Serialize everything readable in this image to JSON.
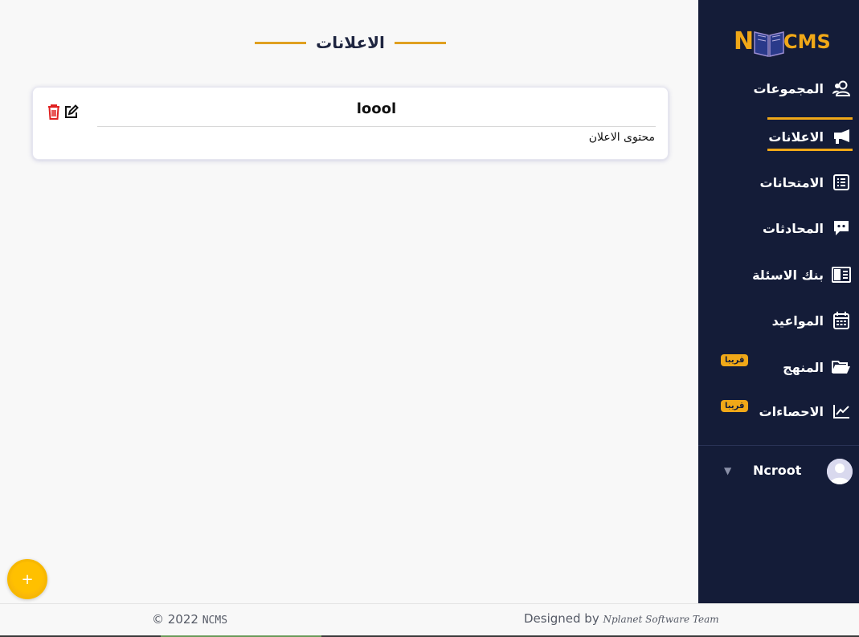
{
  "brand": {
    "logo_n": "N",
    "logo_cms": "CMS"
  },
  "sidebar": {
    "items": [
      {
        "label": "المجموعات",
        "icon": "users-icon"
      },
      {
        "label": "الاعلانات",
        "icon": "megaphone-icon"
      },
      {
        "label": "الامتحانات",
        "icon": "list-icon"
      },
      {
        "label": "المحادثات",
        "icon": "chat-icon"
      },
      {
        "label": "بنك الاسئلة",
        "icon": "book-icon"
      },
      {
        "label": "المواعيد",
        "icon": "calendar-icon"
      },
      {
        "label": "المنهج",
        "icon": "folder-open-icon",
        "badge": "قريبا"
      },
      {
        "label": "الاحصاءات",
        "icon": "chart-line-icon",
        "badge": "قريبا"
      }
    ],
    "active_index": 1,
    "user": {
      "name": "Ncroot"
    }
  },
  "main": {
    "title": "الاعلانات",
    "announcements": [
      {
        "title": "loool",
        "content": "محتوى الاعلان"
      }
    ],
    "fab_label": "+"
  },
  "footer": {
    "copyright_prefix": "© 2022",
    "copyright_brand": "NCMS",
    "designed_prefix": "Designed by",
    "designed_team": "Nplanet Software Team"
  },
  "colors": {
    "sidebar_bg": "#141c38",
    "accent": "#f0a818",
    "delete": "#e02020"
  }
}
